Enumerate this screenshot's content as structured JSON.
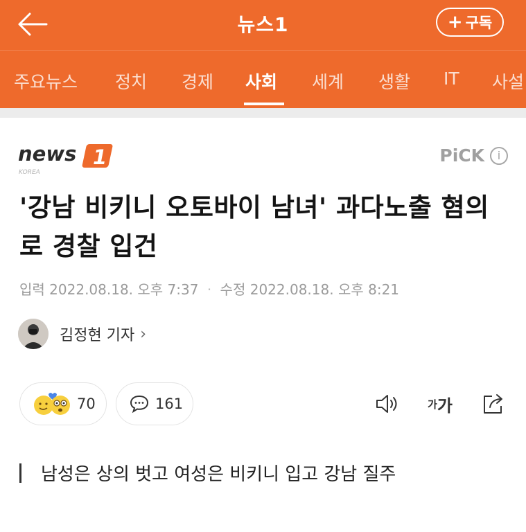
{
  "header": {
    "title": "뉴스1",
    "subscribe_label": "구독",
    "background": "#ee6a2c"
  },
  "tabs": [
    {
      "label": "주요뉴스",
      "active": false
    },
    {
      "label": "정치",
      "active": false
    },
    {
      "label": "경제",
      "active": false
    },
    {
      "label": "사회",
      "active": true
    },
    {
      "label": "세계",
      "active": false
    },
    {
      "label": "생활",
      "active": false
    },
    {
      "label": "IT",
      "active": false
    },
    {
      "label": "사설",
      "active": false
    }
  ],
  "source": {
    "logo_word": "news",
    "logo_number": "1",
    "logo_sub": "KOREA",
    "logo_color": "#ee6a2c",
    "pick_label": "PiCK",
    "pick_info": "i"
  },
  "article": {
    "headline": "'강남 비키니 오토바이 남녀' 과다노출 혐의로 경찰 입건",
    "published_label": "입력",
    "published": "2022.08.18. 오후 7:37",
    "modified_label": "수정",
    "modified": "2022.08.18. 오후 8:21",
    "reporter": "김정현 기자",
    "subheading": "남성은 상의 벗고 여성은 비키니 입고 강남 질주"
  },
  "engagement": {
    "reactions": "70",
    "comments": "161",
    "font_small": "가",
    "font_large": "가"
  }
}
